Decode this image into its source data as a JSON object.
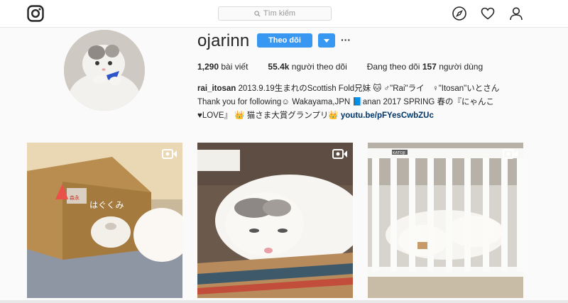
{
  "nav": {
    "search_placeholder": "Tìm kiếm"
  },
  "profile": {
    "username": "ojarinn",
    "follow_label": "Theo dõi",
    "more_label": "···",
    "stats": {
      "posts_count": "1,290",
      "posts_label": "bài viết",
      "followers_count": "55.4k",
      "followers_label": "người theo dõi",
      "following_prefix": "Đang theo dõi",
      "following_count": "157",
      "following_label": "người dùng"
    },
    "bio": {
      "name": "rai_itosan",
      "line1": "2013.9.19生まれのScottish Fold兄妹 🐱 ♂\"Rai\"ライ　♀\"Itosan\"いとさん",
      "line2": "Thank you for following☺ Wakayama,JPN 📘anan 2017 SPRING 春の『にゃんこ",
      "line3_text": "♥LOVE』 👑 猫さま大賞グランプリ👑 ",
      "link": "youtu.be/pFYesCwbZUc"
    }
  },
  "grid": {
    "posts": [
      {
        "type": "video",
        "box_text": "はぐくみ"
      },
      {
        "type": "video"
      },
      {
        "type": "video",
        "crib_label": "KATOJI"
      }
    ]
  },
  "colors": {
    "accent": "#3897f0",
    "link": "#003569",
    "background": "#fafafa"
  },
  "icons": [
    "instagram-logo-icon",
    "search-icon",
    "compass-icon",
    "heart-icon",
    "user-icon",
    "chevron-down-icon",
    "video-icon"
  ]
}
